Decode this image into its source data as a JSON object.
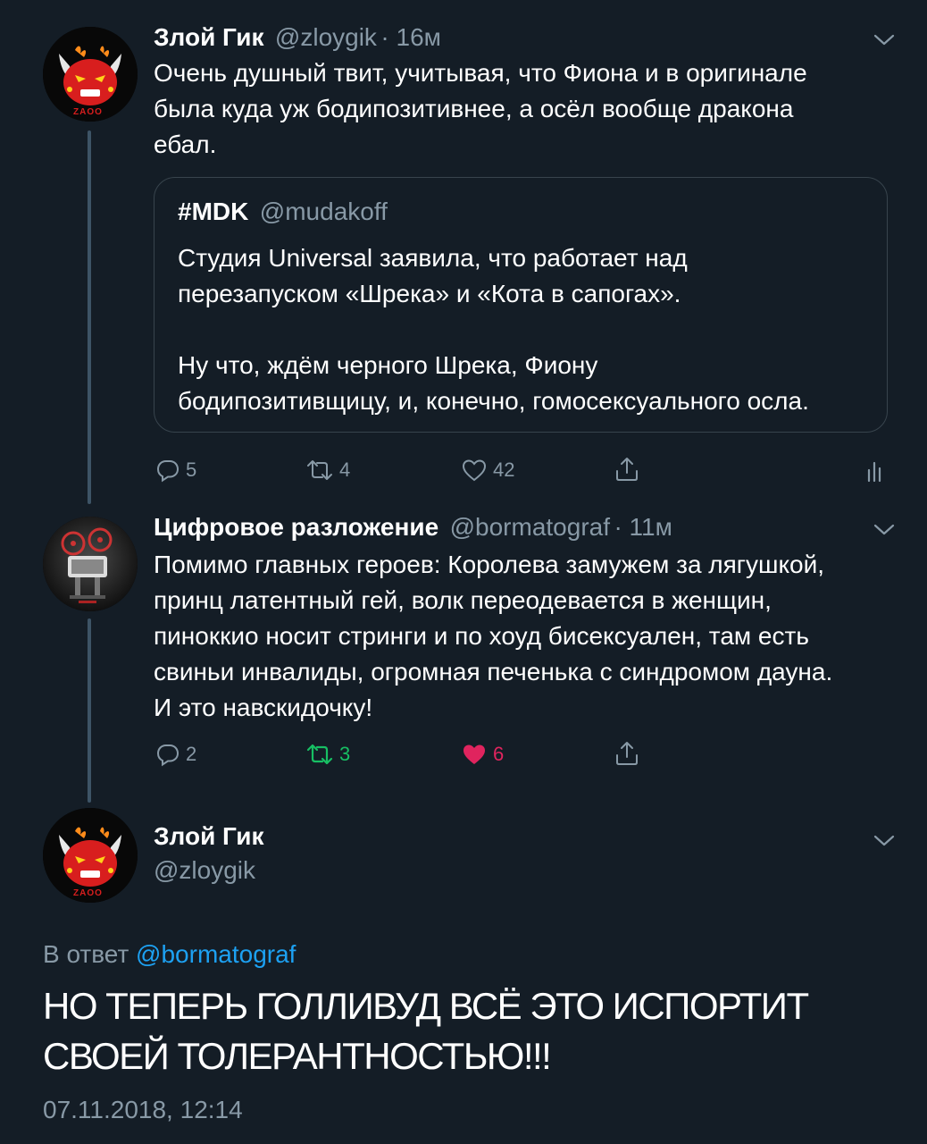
{
  "tweets": [
    {
      "name": "Злой Гик",
      "handle": "@zloygik",
      "time": "· 16м",
      "lines": [
        "Очень душный твит, учитывая, что Фиона и в оригинале",
        "была куда уж бодипозитивнее, а осёл вообще дракона",
        "ебал."
      ],
      "avatar_label": "ZAOO",
      "quote": {
        "name": "#MDK",
        "handle": "@mudakoff",
        "lines": [
          "Студия Universal заявила, что работает над",
          "перезапуском «Шрека» и «Кота в сапогах».",
          "Ну что, ждём черного Шрека, Фиону",
          "бодипозитивщицу, и, конечно, гомосексуального осла."
        ]
      },
      "actions": {
        "replies": "5",
        "retweets": "4",
        "likes": "42"
      }
    },
    {
      "name": "Цифровое разложение",
      "handle": "@bormatograf",
      "time": "· 11м",
      "lines": [
        "Помимо главных героев: Королева замужем за лягушкой,",
        "принц латентный гей, волк переодевается в женщин,",
        "пиноккио носит стринги и по хоуд бисексуален, там есть",
        "свиньи инвалиды, огромная печенька с синдромом дауна.",
        "И это навскидочку!"
      ],
      "actions": {
        "replies": "2",
        "retweets": "3",
        "likes": "6"
      }
    }
  ],
  "main_tweet": {
    "name": "Злой Гик",
    "handle": "@zloygik",
    "avatar_label": "ZAOO",
    "reply_prefix": "В ответ",
    "reply_to": "@bormatograf",
    "lines": [
      "НО ТЕПЕРЬ ГОЛЛИВУД ВСЁ ЭТО ИСПОРТИТ",
      "СВОЕЙ ТОЛЕРАНТНОСТЬЮ!!!"
    ],
    "timestamp": "07.11.2018, 12:14"
  },
  "colors": {
    "background": "#141d26",
    "secondary_text": "#8899a6",
    "link": "#1da1f2",
    "retweet_active": "#17bf63",
    "like_active": "#e0245e",
    "thread_line": "#3d5466"
  },
  "icons": [
    "chevron-down-icon",
    "reply-icon",
    "retweet-icon",
    "like-icon",
    "share-icon",
    "analytics-icon"
  ]
}
